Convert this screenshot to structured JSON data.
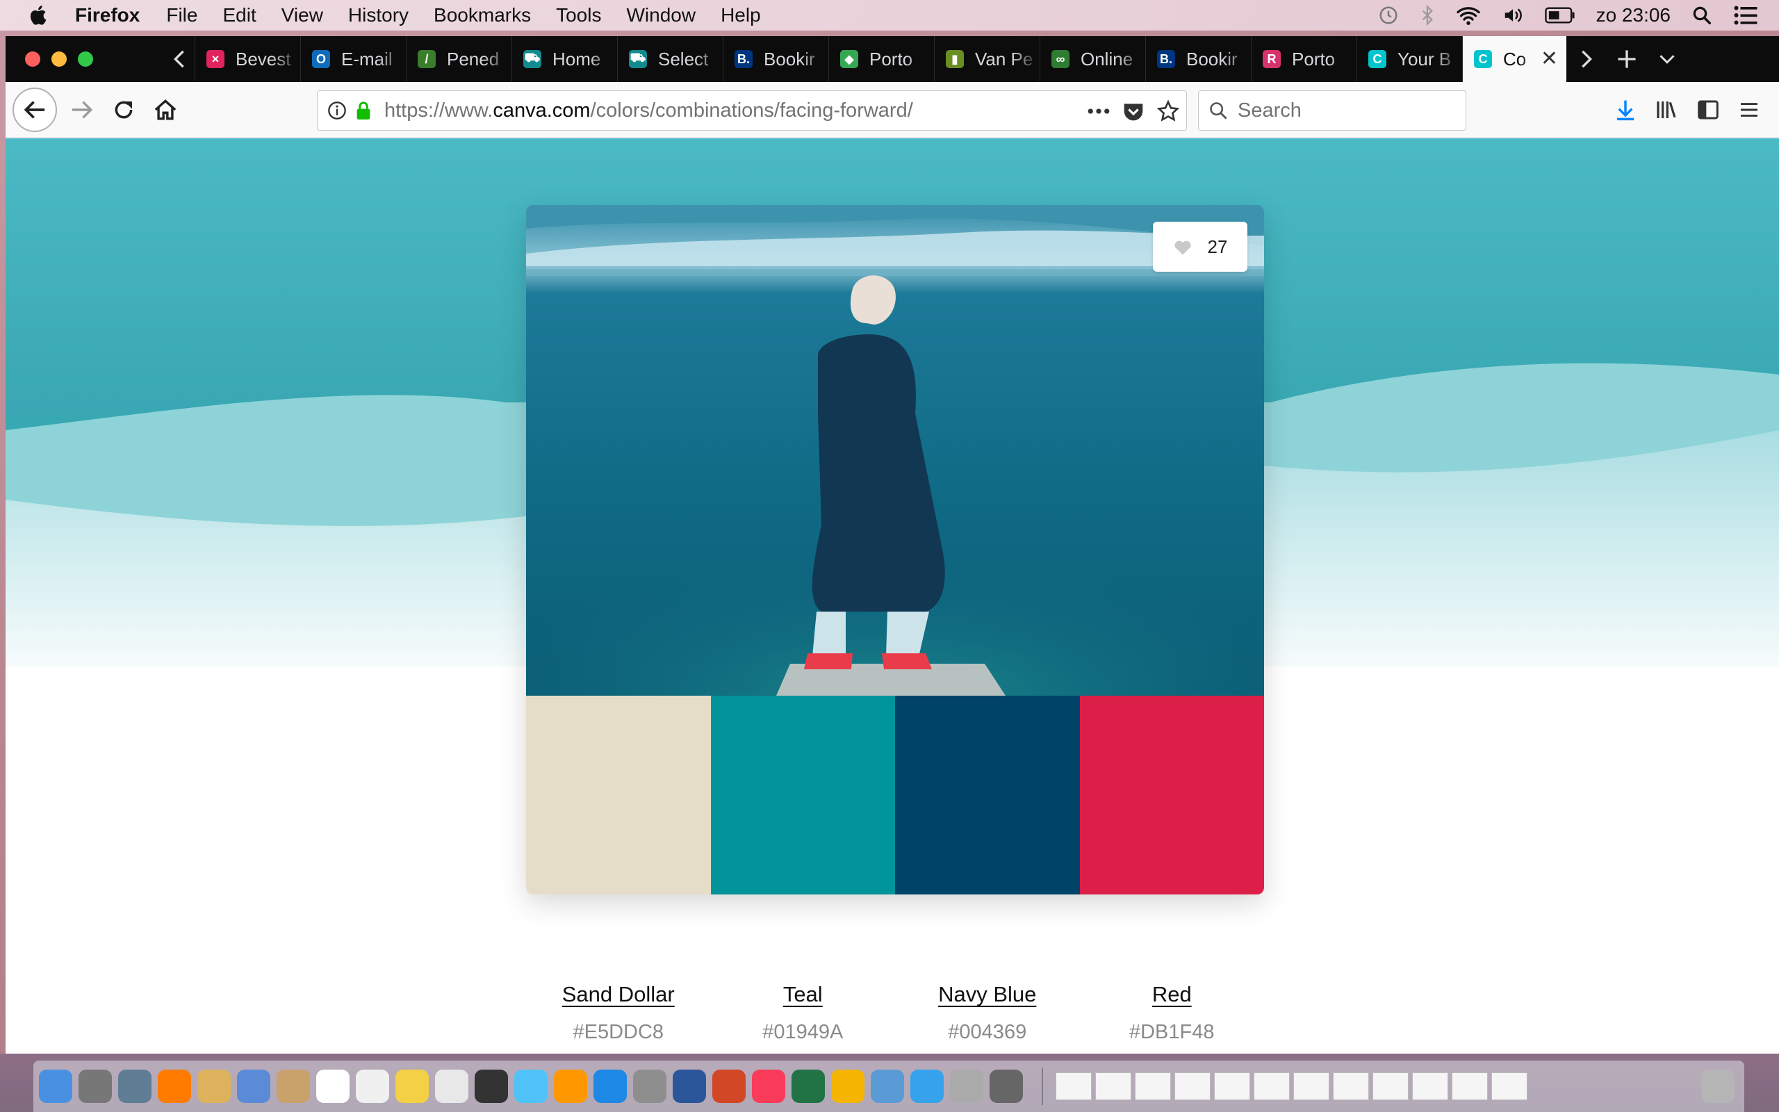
{
  "menubar": {
    "app_name": "Firefox",
    "menus": [
      "File",
      "Edit",
      "View",
      "History",
      "Bookmarks",
      "Tools",
      "Window",
      "Help"
    ],
    "clock": "zo 23:06"
  },
  "tabs": [
    {
      "label": "Bevest",
      "fav_color": "#e0245e",
      "fav_glyph": "×"
    },
    {
      "label": "E-mail",
      "fav_color": "#0f6cbd",
      "fav_glyph": "O"
    },
    {
      "label": "Pened",
      "fav_color": "#3a7d2a",
      "fav_glyph": "/"
    },
    {
      "label": "Home",
      "fav_color": "#138a8f",
      "fav_glyph": "⛟"
    },
    {
      "label": "Select",
      "fav_color": "#138a8f",
      "fav_glyph": "⛟"
    },
    {
      "label": "Bookir",
      "fav_color": "#003580",
      "fav_glyph": "B."
    },
    {
      "label": "Porto",
      "fav_color": "#34a853",
      "fav_glyph": "◆"
    },
    {
      "label": "Van Pe",
      "fav_color": "#6b8e23",
      "fav_glyph": "▮"
    },
    {
      "label": "Online",
      "fav_color": "#2e7d32",
      "fav_glyph": "∞"
    },
    {
      "label": "Bookir",
      "fav_color": "#003580",
      "fav_glyph": "B."
    },
    {
      "label": "Porto",
      "fav_color": "#d6336c",
      "fav_glyph": "R"
    },
    {
      "label": "Your B",
      "fav_color": "#00c4cc",
      "fav_glyph": "C"
    },
    {
      "label": "Co",
      "fav_color": "#00c4cc",
      "fav_glyph": "C",
      "active": true
    }
  ],
  "urlbar": {
    "scheme": "https://www.",
    "host": "canva.com",
    "path": "/colors/combinations/facing-forward/"
  },
  "searchbar": {
    "placeholder": "Search"
  },
  "card": {
    "likes": "27",
    "palette": [
      {
        "name": "Sand Dollar",
        "hex": "#E5DDC8"
      },
      {
        "name": "Teal",
        "hex": "#01949A"
      },
      {
        "name": "Navy Blue",
        "hex": "#004369"
      },
      {
        "name": "Red",
        "hex": "#DB1F48"
      }
    ]
  },
  "colors": {
    "hero_teal": "#4bbac5",
    "wave_light": "#8ed3d8"
  },
  "icons": {
    "apple": "apple-logo-icon",
    "back": "arrow-left-icon",
    "forward": "arrow-right-icon",
    "reload": "reload-icon",
    "home": "home-icon",
    "info": "info-icon",
    "lock": "lock-icon",
    "more": "ellipsis-icon",
    "pocket": "pocket-icon",
    "bookmark": "star-icon",
    "download": "download-icon",
    "library": "library-icon",
    "sidebar": "sidebar-icon",
    "menu": "hamburger-icon",
    "heart": "heart-icon"
  }
}
